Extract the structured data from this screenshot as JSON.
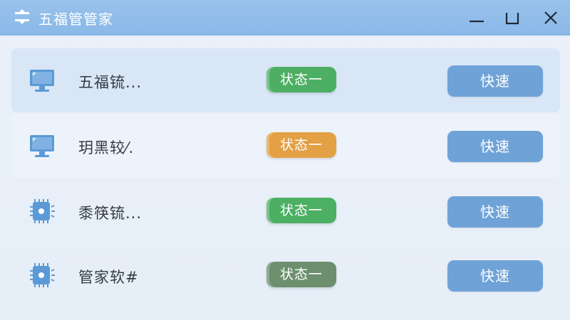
{
  "window": {
    "title": "五福管管家",
    "app_icon": "filter-icon",
    "controls": [
      "minimize-icon",
      "maximize-icon",
      "close-icon"
    ]
  },
  "colors": {
    "titlebar": "#8ab8e8",
    "button": "#6fa3d8",
    "status_green": "#4caf63",
    "status_orange": "#e3a044",
    "status_darkgreen": "#6d8f6d"
  },
  "rows": [
    {
      "icon": "monitor-icon",
      "label": "五福锍...",
      "status": "状态一",
      "status_color": "#4caf63",
      "action": "快速"
    },
    {
      "icon": "monitor-icon",
      "label": "玥黑较⁄.",
      "status": "状态一",
      "status_color": "#e3a044",
      "action": "快速"
    },
    {
      "icon": "chip-icon",
      "label": "黍筷锍...",
      "status": "状态一",
      "status_color": "#4caf63",
      "action": "快速"
    },
    {
      "icon": "chip-icon",
      "label": "管家软#",
      "status": "状态一",
      "status_color": "#6d8f6d",
      "action": "快速"
    }
  ]
}
